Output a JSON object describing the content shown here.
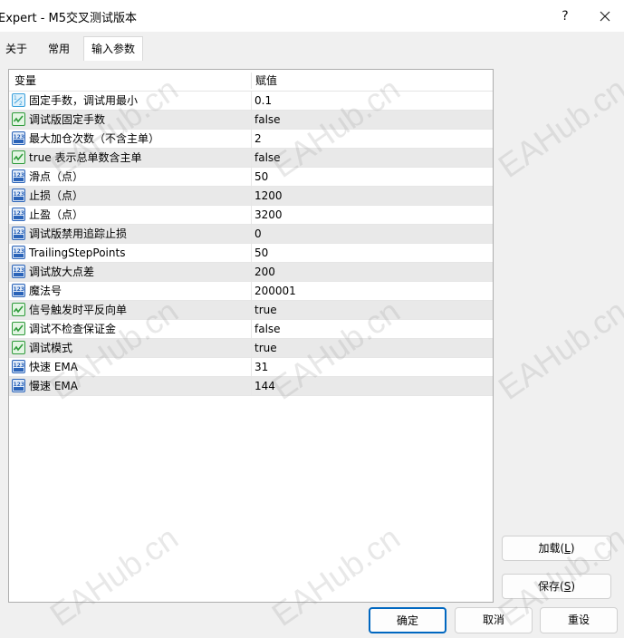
{
  "window": {
    "title": "Expert - M5交叉测试版本",
    "help_glyph": "?"
  },
  "tabs": [
    {
      "label": "关于"
    },
    {
      "label": "常用"
    },
    {
      "label": "输入参数"
    }
  ],
  "grid": {
    "headers": {
      "name": "变量",
      "value": "赋值"
    },
    "rows": [
      {
        "icon": "fraction-icon",
        "name": "固定手数，调试用最小",
        "value": "0.1"
      },
      {
        "icon": "boolean-icon",
        "name": "调试版固定手数",
        "value": "false"
      },
      {
        "icon": "integer-icon",
        "name": "最大加仓次数（不含主单）",
        "value": "2"
      },
      {
        "icon": "boolean-icon",
        "name": "true 表示总单数含主单",
        "value": "false"
      },
      {
        "icon": "integer-icon",
        "name": "滑点（点）",
        "value": "50"
      },
      {
        "icon": "integer-icon",
        "name": "止损（点）",
        "value": "1200"
      },
      {
        "icon": "integer-icon",
        "name": "止盈（点）",
        "value": "3200"
      },
      {
        "icon": "integer-icon",
        "name": "调试版禁用追踪止损",
        "value": "0"
      },
      {
        "icon": "integer-icon",
        "name": "TrailingStepPoints",
        "value": "50"
      },
      {
        "icon": "integer-icon",
        "name": "调试放大点差",
        "value": "200"
      },
      {
        "icon": "integer-icon",
        "name": "魔法号",
        "value": "200001"
      },
      {
        "icon": "boolean-icon",
        "name": "信号触发时平反向单",
        "value": "true"
      },
      {
        "icon": "boolean-icon",
        "name": "调试不检查保证金",
        "value": "false"
      },
      {
        "icon": "boolean-icon",
        "name": "调试模式",
        "value": "true"
      },
      {
        "icon": "integer-icon",
        "name": "快速 EMA",
        "value": "31"
      },
      {
        "icon": "integer-icon",
        "name": "慢速 EMA",
        "value": "144"
      }
    ]
  },
  "buttons": {
    "load": {
      "label": "加载(",
      "hotkey": "L",
      "suffix": ")"
    },
    "save": {
      "label": "保存(",
      "hotkey": "S",
      "suffix": ")"
    },
    "ok": "确定",
    "cancel": "取消",
    "reset": "重设"
  },
  "watermark": "EAHub.cn",
  "colors": {
    "accent": "#0067c0",
    "row_alt": "#e9e9e9",
    "icon_fraction": "#3aa0dc",
    "icon_boolean": "#2e9a3a",
    "icon_integer": "#2a63b8"
  }
}
